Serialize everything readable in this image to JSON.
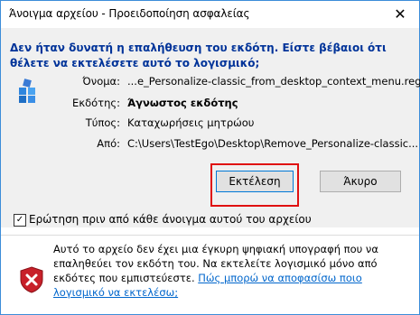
{
  "window": {
    "title": "Άνοιγμα αρχείου - Προειδοποίηση ασφαλείας"
  },
  "question": "Δεν ήταν δυνατή η επαλήθευση του εκδότη. Είστε βέβαιοι ότι θέλετε να εκτελέσετε αυτό το λογισμικό;",
  "details": {
    "name_label": "Όνομα:",
    "name_value": "...e_Personalize-classic_from_desktop_context_menu.reg",
    "publisher_label": "Εκδότης:",
    "publisher_value": "Άγνωστος εκδότης",
    "type_label": "Τύπος:",
    "type_value": "Καταχωρήσεις μητρώου",
    "from_label": "Από:",
    "from_value": "C:\\Users\\TestEgo\\Desktop\\Remove_Personalize-classic..."
  },
  "buttons": {
    "run": "Εκτέλεση",
    "cancel": "Άκυρο"
  },
  "checkbox": {
    "label": "Ερώτηση πριν από κάθε άνοιγμα αυτού του αρχείου",
    "checked": true
  },
  "warning": {
    "text": "Αυτό το αρχείο δεν έχει μια έγκυρη ψηφιακή υπογραφή που να επαληθεύει τον εκδότη του. Να εκτελείτε λογισμικό μόνο από εκδότες που εμπιστεύεστε.",
    "link": "Πώς μπορώ να αποφασίσω ποιο λογισμικό να εκτελέσω;"
  },
  "colors": {
    "question": "#003399",
    "link": "#0066cc",
    "highlight": "#e01010",
    "border": "#3c8dd9"
  }
}
